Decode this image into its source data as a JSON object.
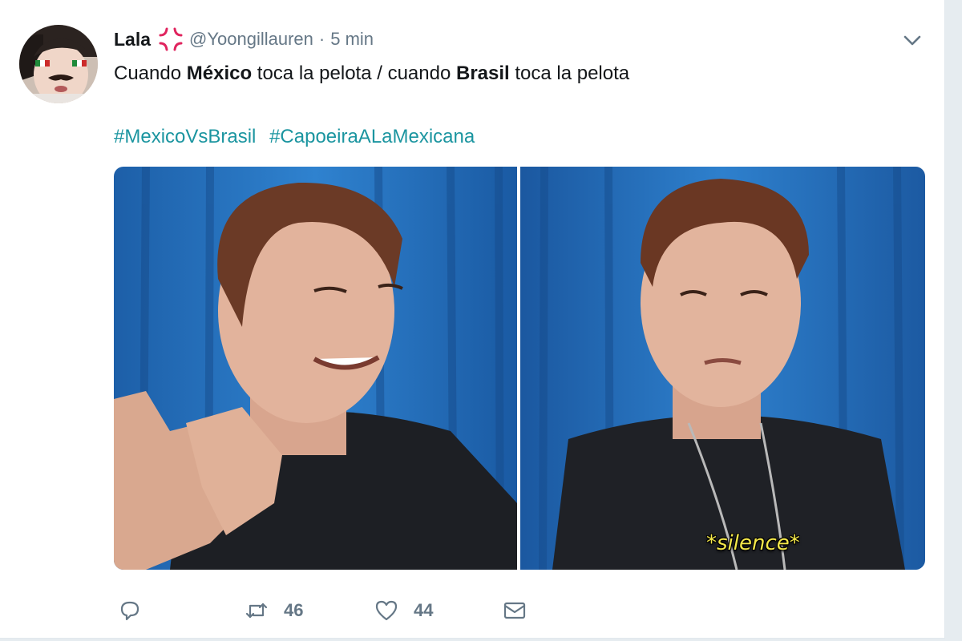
{
  "user": {
    "name": "Lala",
    "handle": "@Yoongillauren",
    "separator": "·",
    "time": "5 min",
    "emoji": "anger-symbol-icon"
  },
  "tweet": {
    "text_1": "Cuando ",
    "bold_1": "México",
    "text_2": " toca la pelota / cuando ",
    "bold_2": "Brasil",
    "text_3": " toca la pelota",
    "hashtags": [
      "#MexicoVsBrasil",
      "#CapoeiraALaMexicana"
    ]
  },
  "media": {
    "right_caption": "*silence*"
  },
  "actions": {
    "reply_icon": "reply-icon",
    "retweet_icon": "retweet-icon",
    "retweet_count": "46",
    "like_icon": "heart-icon",
    "like_count": "44",
    "dm_icon": "envelope-icon"
  },
  "colors": {
    "hashtag": "#1b95a0",
    "muted": "#657786",
    "text": "#14171a",
    "emoji_red": "#e0245e"
  }
}
